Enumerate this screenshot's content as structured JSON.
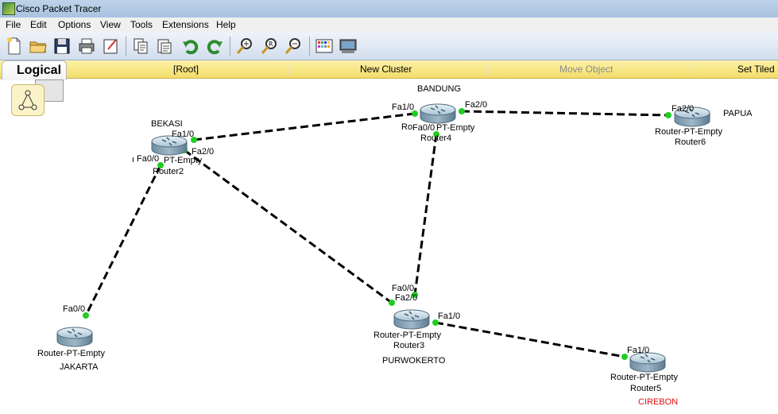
{
  "window": {
    "title": "Cisco Packet Tracer"
  },
  "menu": {
    "items": [
      "File",
      "Edit",
      "Options",
      "View",
      "Tools",
      "Extensions",
      "Help"
    ]
  },
  "toolbar": {
    "buttons": [
      "new-icon",
      "open-icon",
      "save-icon",
      "print-icon",
      "activity-wizard-icon",
      "copy-icon",
      "paste-icon",
      "undo-icon",
      "redo-icon",
      "zoom-in-icon",
      "zoom-reset-icon",
      "zoom-out-icon",
      "palette-icon",
      "device-template-icon"
    ]
  },
  "logical_bar": {
    "tab_label": "Logical",
    "root": "[Root]",
    "new_cluster": "New Cluster",
    "move_object": "Move Object",
    "set_tiled": "Set Tiled"
  },
  "topology": {
    "routers": [
      {
        "id": "router2",
        "model": "PT-Empty",
        "name": "Router2",
        "model_prefix": "Router-",
        "location": "BEKASI",
        "location_color": "#000000"
      },
      {
        "id": "router4",
        "model": "Router-PT-Empty",
        "name": "Router4",
        "location": "BANDUNG",
        "location_color": "#000000"
      },
      {
        "id": "router6",
        "model": "Router-PT-Empty",
        "name": "Router6",
        "location": "PAPUA",
        "location_color": "#000000"
      },
      {
        "id": "router1",
        "model": "Router-PT-Empty",
        "name": "",
        "location": "JAKARTA",
        "location_color": "#000000"
      },
      {
        "id": "router3",
        "model": "Router-PT-Empty",
        "name": "Router3",
        "location": "PURWOKERTO",
        "location_color": "#000000"
      },
      {
        "id": "router5",
        "model": "Router-PT-Empty",
        "name": "Router5",
        "location": "CIREBON",
        "location_color": "#e01010"
      }
    ],
    "links": [
      {
        "from": "router2",
        "from_port": "Fa1/0",
        "to": "router4",
        "to_port": "Fa1/0"
      },
      {
        "from": "router4",
        "from_port": "Fa2/0",
        "to": "router6",
        "to_port": "Fa2/0"
      },
      {
        "from": "router2",
        "from_port": "Fa0/0",
        "to": "router1",
        "to_port": "Fa0/0"
      },
      {
        "from": "router2",
        "from_port": "Fa2/0",
        "to": "router3",
        "to_port": "Fa2/0"
      },
      {
        "from": "router4",
        "from_port": "Fa0/0",
        "to": "router3",
        "to_port": "Fa0/0"
      },
      {
        "from": "router3",
        "from_port": "Fa1/0",
        "to": "router5",
        "to_port": "Fa1/0"
      }
    ],
    "router4_partial_label": "Ro"
  },
  "colors": {
    "link_light": "#22cc22",
    "link_line": "#000000",
    "accent_yellow": "#f2dd6a"
  }
}
